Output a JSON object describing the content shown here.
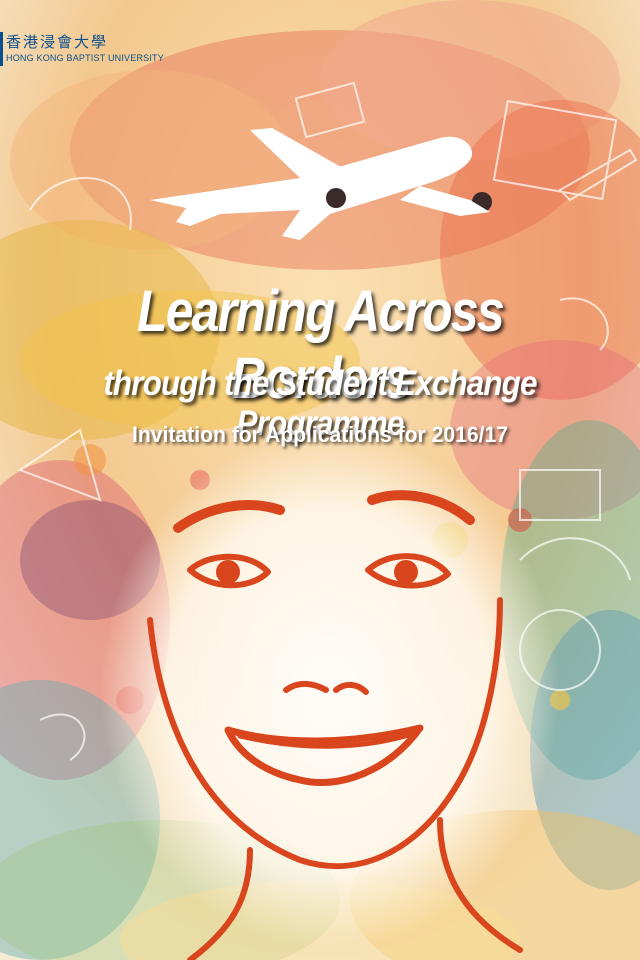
{
  "logo": {
    "chinese_name": "香港浸會大學",
    "english_name": "HONG KONG BAPTIST UNIVERSITY"
  },
  "poster": {
    "title": "Learning Across Borders",
    "subtitle": "through the Student Exchange Programme",
    "invitation": "Invitation for Applications for 2016/17"
  },
  "colors": {
    "brand_blue": "#0a4f8f",
    "face_line": "#d9451c",
    "text": "#ffffff"
  }
}
